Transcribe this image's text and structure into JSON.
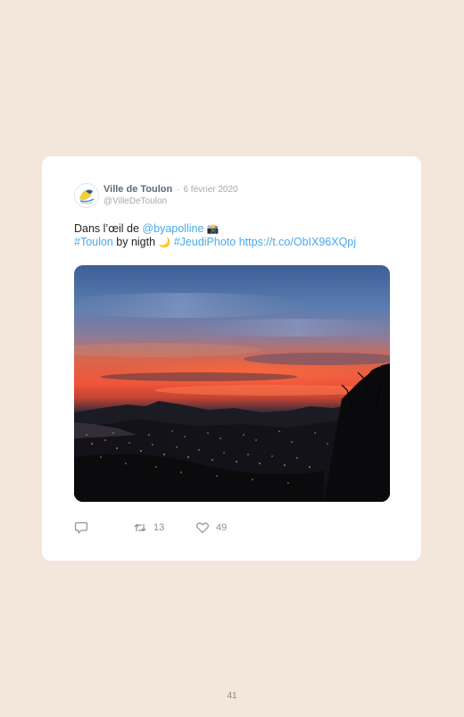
{
  "tweet": {
    "author_name": "Ville de Toulon",
    "separator": "·",
    "date": "6 février 2020",
    "handle": "@VilleDeToulon",
    "text_line1": {
      "prefix": "Dans l’œil de ",
      "mention": "@byapolline",
      "emoji": "📸"
    },
    "text_line2": {
      "hashtag1": "#Toulon",
      "middle": " by nigth ",
      "emoji": "🌙",
      "hashtag2": "#JeudiPhoto",
      "url": "https://t.co/ObIX96XQpj"
    },
    "link_color": "#4aa9e8"
  },
  "actions": {
    "reply_icon": "reply-icon",
    "retweet_icon": "retweet-icon",
    "retweet_count": "13",
    "like_icon": "heart-icon",
    "like_count": "49"
  },
  "page": {
    "number": "41",
    "background": "#f3e6da"
  }
}
